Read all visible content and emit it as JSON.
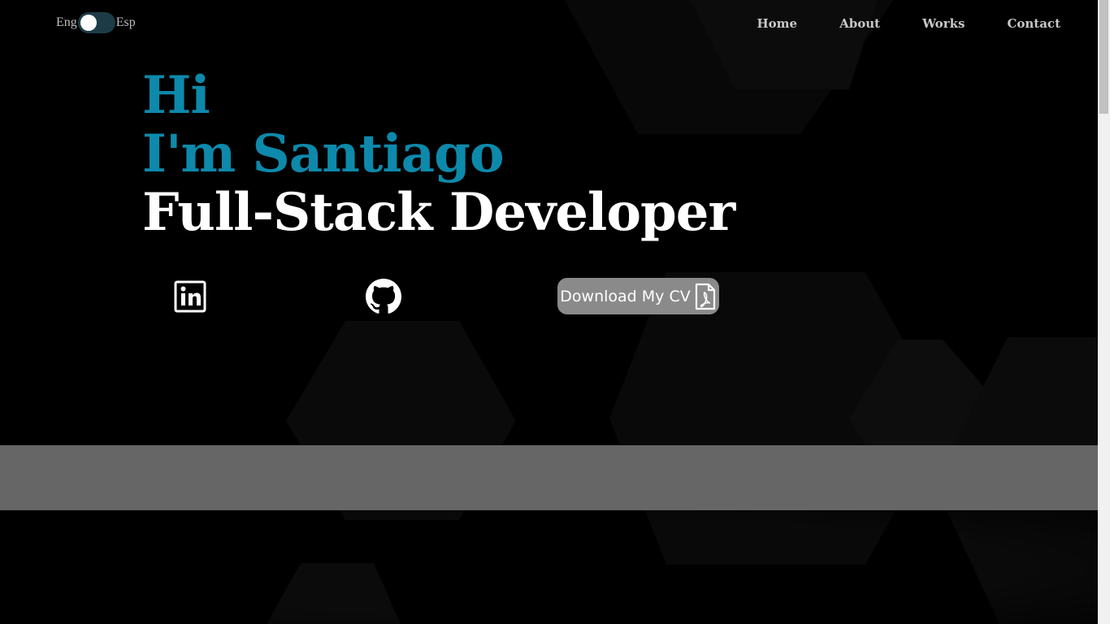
{
  "lang_toggle": {
    "left_label": "Eng",
    "right_label": "Esp",
    "state": "off"
  },
  "nav": {
    "items": [
      "Home",
      "About",
      "Works",
      "Contact"
    ]
  },
  "hero": {
    "line1": "Hi",
    "line2": "I'm Santiago",
    "line3": "Full-Stack Developer"
  },
  "socials": {
    "linkedin_icon": "linkedin-icon",
    "github_icon": "github-icon"
  },
  "cv_button": {
    "label": "Download My CV",
    "icon": "pdf-file-icon"
  },
  "colors": {
    "accent": "#0d89ab",
    "background": "#000000",
    "band": "#666666",
    "toggle": "#1d3b47",
    "button": "#8a8a8a"
  }
}
